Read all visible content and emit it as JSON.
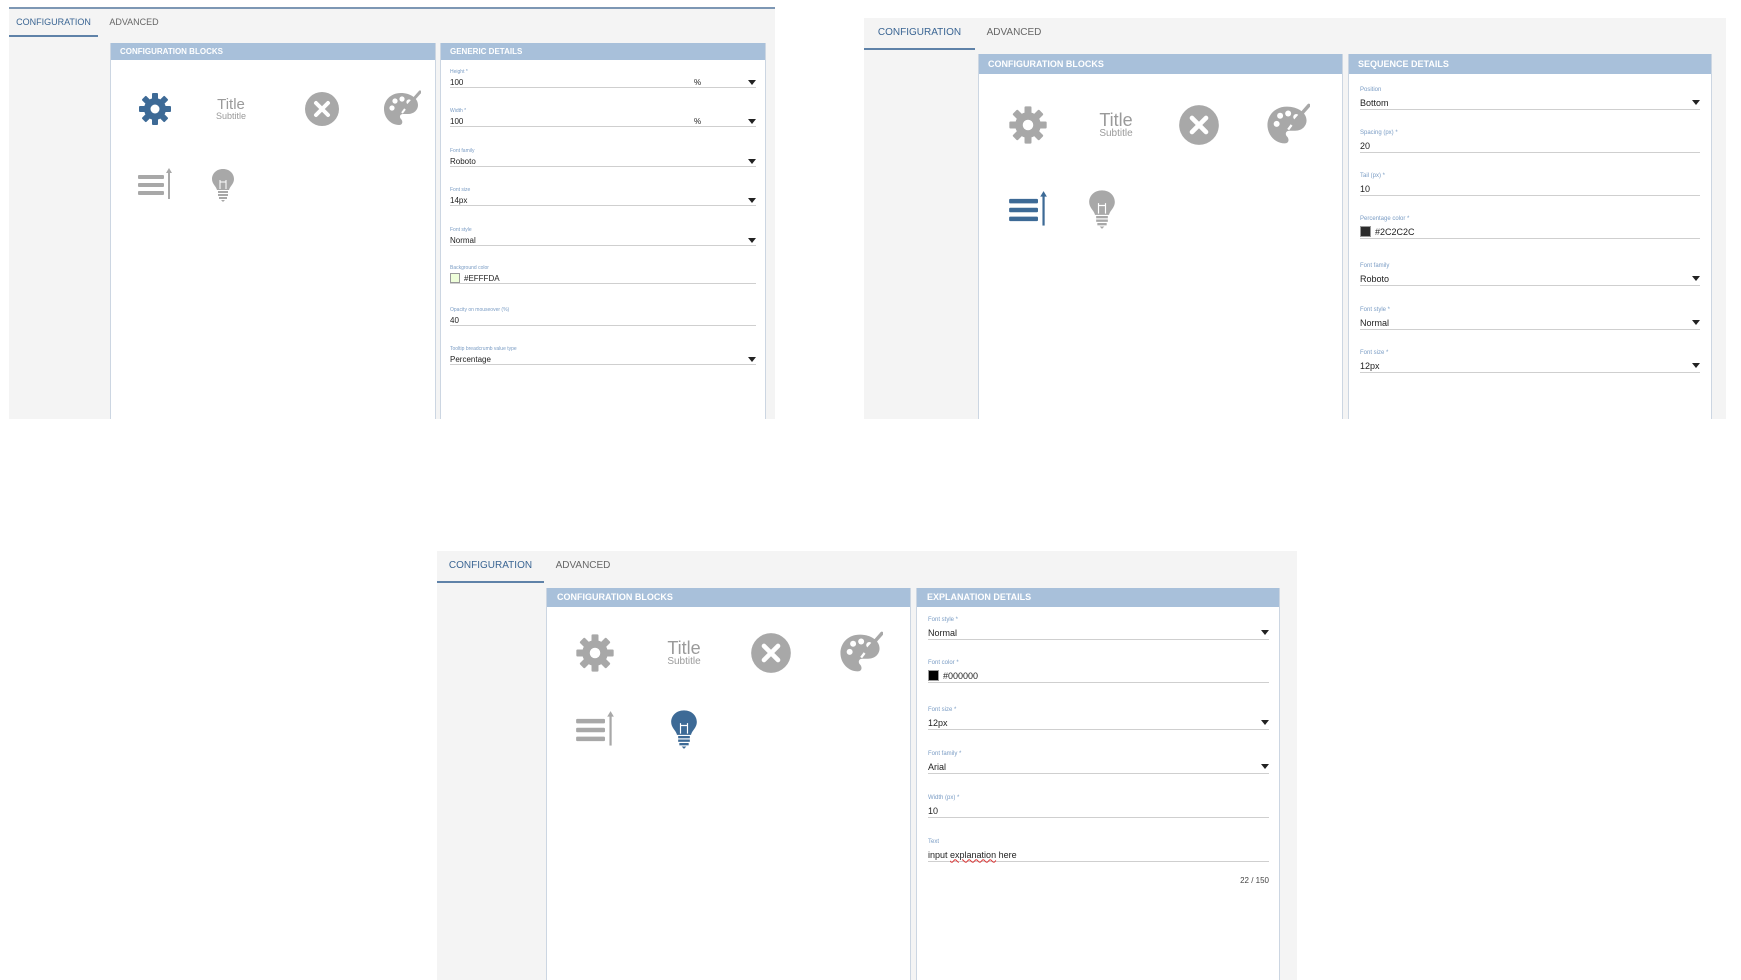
{
  "colors": {
    "accent": "#3a6593",
    "header": "#a8c0da",
    "icon_gray": "#a8a8a8",
    "icon_active": "#3d6a96"
  },
  "tabs": {
    "configuration": "CONFIGURATION",
    "advanced": "ADVANCED"
  },
  "blocks": {
    "title_text": "Title",
    "subtitle_text": "Subtitle",
    "icons": [
      "gear-icon",
      "title-subtitle-icon",
      "close-circle-icon",
      "palette-icon",
      "list-sequence-icon",
      "lightbulb-icon"
    ]
  },
  "screen1": {
    "left_header": "CONFIGURATION BLOCKS",
    "right_header": "GENERIC DETAILS",
    "active_block": "gear-icon",
    "fields": [
      {
        "label": "Height *",
        "value": "100",
        "unit": "%"
      },
      {
        "label": "Width *",
        "value": "100",
        "unit": "%"
      },
      {
        "label": "Font family",
        "value": "Roboto"
      },
      {
        "label": "Font size",
        "value": "14px"
      },
      {
        "label": "Font style",
        "value": "Normal"
      },
      {
        "label": "Background color",
        "value": "#EFFFDA",
        "swatch": "#EFFFDA"
      },
      {
        "label": "Opacity on mouseover (%)",
        "value": "40"
      },
      {
        "label": "Tooltip breadcrumb value type",
        "value": "Percentage"
      }
    ]
  },
  "screen2": {
    "left_header": "CONFIGURATION BLOCKS",
    "right_header": "SEQUENCE DETAILS",
    "active_block": "list-sequence-icon",
    "fields": [
      {
        "label": "Position",
        "value": "Bottom"
      },
      {
        "label": "Spacing (px) *",
        "value": "20"
      },
      {
        "label": "Tail (px) *",
        "value": "10"
      },
      {
        "label": "Percentage color *",
        "value": "#2C2C2C",
        "swatch": "#2C2C2C"
      },
      {
        "label": "Font family",
        "value": "Roboto"
      },
      {
        "label": "Font style *",
        "value": "Normal"
      },
      {
        "label": "Font size *",
        "value": "12px"
      }
    ]
  },
  "screen3": {
    "left_header": "CONFIGURATION BLOCKS",
    "right_header": "EXPLANATION DETAILS",
    "active_block": "lightbulb-icon",
    "fields": [
      {
        "label": "Font style *",
        "value": "Normal"
      },
      {
        "label": "Font color *",
        "value": "#000000",
        "swatch": "#000000"
      },
      {
        "label": "Font size *",
        "value": "12px"
      },
      {
        "label": "Font family *",
        "value": "Arial"
      },
      {
        "label": "Width (px) *",
        "value": "10"
      },
      {
        "label": "Text",
        "value_pre": "input ",
        "value_spell": "explanation",
        "value_post": " here"
      }
    ],
    "counter": "22 / 150"
  }
}
